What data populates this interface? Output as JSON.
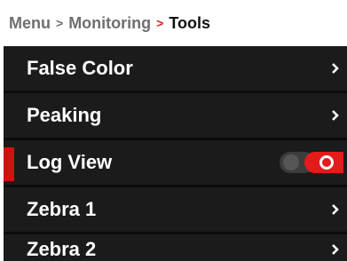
{
  "breadcrumb": {
    "items": [
      "Menu",
      "Monitoring",
      "Tools"
    ],
    "separator": ">"
  },
  "menu": {
    "items": [
      {
        "label": "False Color",
        "type": "submenu"
      },
      {
        "label": "Peaking",
        "type": "submenu"
      },
      {
        "label": "Log View",
        "type": "toggle",
        "state": "on",
        "selected": true
      },
      {
        "label": "Zebra 1",
        "type": "submenu"
      },
      {
        "label": "Zebra 2",
        "type": "submenu"
      }
    ]
  },
  "colors": {
    "accent": "#e51a1a",
    "menu_background": "#1b1b1b",
    "text": "#ffffff"
  },
  "icons": {
    "chevron": "chevron-right-icon",
    "toggle": "toggle-switch"
  }
}
